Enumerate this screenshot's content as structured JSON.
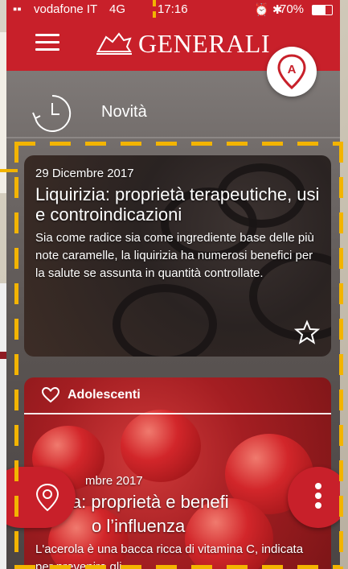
{
  "status_bar": {
    "carrier": "vodafone IT",
    "network": "4G",
    "time": "17:16",
    "battery": "70%"
  },
  "app_bar": {
    "brand": "GENERALI",
    "menu_icon": "hamburger-icon",
    "avatar_letter": "A"
  },
  "section": {
    "title": "Novità",
    "icon": "clock-icon"
  },
  "articles": [
    {
      "date": "29 Dicembre 2017",
      "title": "Liquirizia: proprietà terapeutiche, usi e controindicazioni",
      "excerpt": "Sia come radice sia come ingrediente base delle più note caramelle, la liquirizia ha numerosi benefici per la salute se assunta in quantità controllate."
    },
    {
      "tag": "Adolescenti",
      "date": "mbre 2017",
      "title_line1": "la: proprietà e benefi",
      "title_line2": "o l’influenza",
      "excerpt": "L'acerola è una bacca ricca di vitamina C, indicata per prevenire gli"
    }
  ],
  "colors": {
    "brand_red": "#c8202a",
    "highlight_dash": "#f3b400"
  }
}
